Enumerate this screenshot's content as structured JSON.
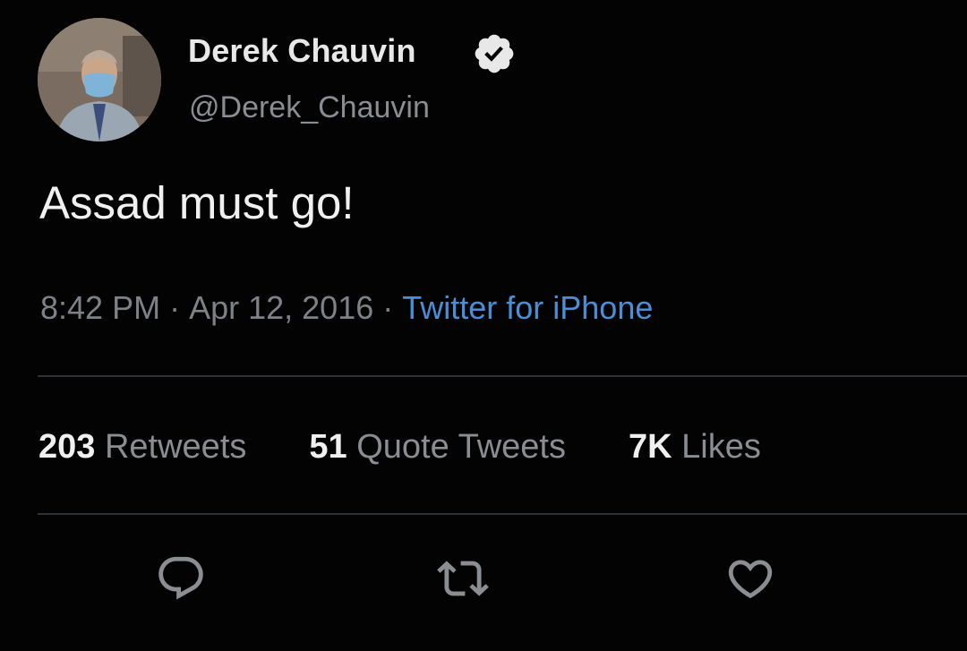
{
  "author": {
    "display_name": "Derek Chauvin",
    "handle": "@Derek_Chauvin",
    "verified": true
  },
  "tweet": {
    "text": "Assad must go!",
    "time": "8:42 PM",
    "date": "Apr 12, 2016",
    "separator": "·",
    "source": "Twitter for iPhone"
  },
  "stats": {
    "retweets_count": "203",
    "retweets_label": "Retweets",
    "quotes_count": "51",
    "quotes_label": "Quote Tweets",
    "likes_count": "7K",
    "likes_label": "Likes"
  },
  "actions": [
    {
      "icon": "reply-icon"
    },
    {
      "icon": "retweet-icon"
    },
    {
      "icon": "like-icon"
    }
  ],
  "colors": {
    "background": "#030303",
    "source_link": "#4a8fd6",
    "muted_text": "#8a8d91",
    "divider": "#2f3336"
  }
}
